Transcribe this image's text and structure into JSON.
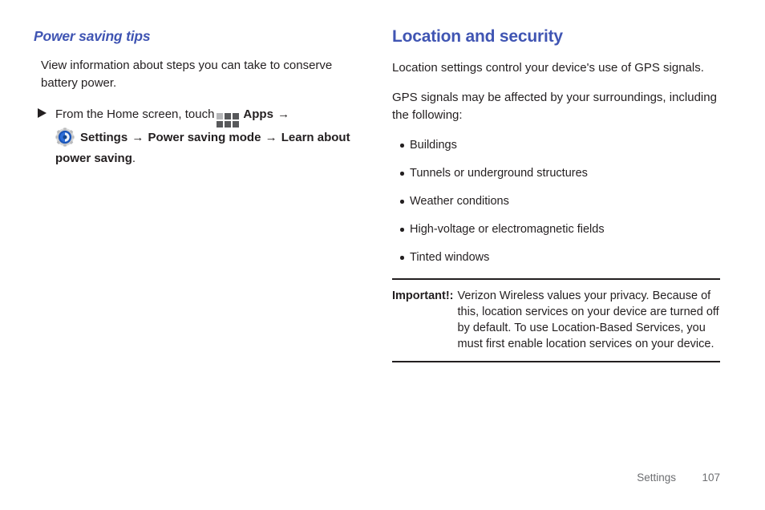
{
  "page": {
    "background": "#ffffff",
    "heading_color": "#4055b3",
    "text_color": "#231f20",
    "footer_color": "#6d6e71"
  },
  "left_column": {
    "heading": "Power saving tips",
    "intro": "View information about steps you can take to conserve battery power.",
    "step": {
      "marker": "triangle-bullet",
      "lead_text": "From the Home screen, touch",
      "apps_icon_name": "apps-grid-icon",
      "apps_label": "Apps",
      "arrow_1": "→",
      "gear_icon_name": "settings-gear-icon",
      "settings_label": "Settings",
      "arrow_2": "→",
      "power_saving_mode_label": "Power saving mode",
      "arrow_3": "→",
      "learn_label": "Learn about power saving",
      "period": "."
    }
  },
  "right_column": {
    "heading": "Location and security",
    "paragraph_1": "Location settings control your device's use of GPS signals.",
    "paragraph_2": "GPS signals may be affected by your surroundings, including the following:",
    "bullets": [
      "Buildings",
      "Tunnels or underground structures",
      "Weather conditions",
      "High-voltage or electromagnetic fields",
      "Tinted windows"
    ],
    "callout": {
      "label": "Important!:",
      "text": "Verizon Wireless values your privacy. Because of this, location services on your device are turned off by default. To use Location-Based Services, you must first enable location services on your device."
    }
  },
  "footer": {
    "section": "Settings",
    "page_number": "107"
  }
}
